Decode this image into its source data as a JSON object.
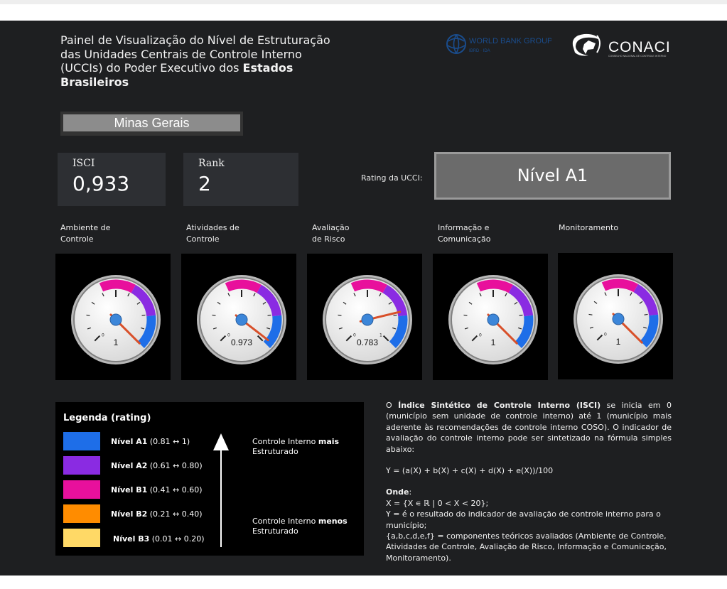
{
  "header": {
    "title_line1": "Painel de Visualização do Nível de Estruturação",
    "title_line2": "das Unidades Centrais de Controle Interno",
    "title_line3_a": "(UCCIs) do Poder Executivo dos ",
    "title_line3_b": "Estados",
    "title_line4": "Brasileiros",
    "logo1_text": "WORLD BANK GROUP",
    "logo1_sub": "IBRD · IDA",
    "logo2_text": "CONACI",
    "logo2_sub": "CONSELHO NACIONAL DE CONTROLE INTERNO"
  },
  "state_selector": {
    "value": "Minas Gerais"
  },
  "kpis": {
    "isci_label": "ISCI",
    "isci_value": "0,933",
    "rank_label": "Rank",
    "rank_value": "2"
  },
  "rating": {
    "label": "Rating da UCCI:",
    "value": "Nível A1"
  },
  "gauges": [
    {
      "label_1": "Ambiente de",
      "label_2": "Controle",
      "value": 1,
      "display": "1",
      "zero": "0"
    },
    {
      "label_1": "Atividades de",
      "label_2": "Controle",
      "value": 0.973,
      "display": "0.973",
      "zero": "0"
    },
    {
      "label_1": "Avaliação",
      "label_2": "de Risco",
      "value": 0.783,
      "display": "0.783",
      "zero": "0",
      "one": "1"
    },
    {
      "label_1": "Informação e",
      "label_2": "Comunicação",
      "value": 1,
      "display": "1",
      "zero": "0"
    },
    {
      "label_1": "Monitoramento",
      "label_2": "",
      "value": 1,
      "display": "1",
      "zero": "0"
    }
  ],
  "legend": {
    "title": "Legenda (rating)",
    "items": [
      {
        "name": "Nível A1",
        "range": "(0.81 ↔ 1)",
        "color": "#1e6ee8"
      },
      {
        "name": "Nível A2",
        "range": "(0.61 ↔ 0.80)",
        "color": "#8a2be2"
      },
      {
        "name": "Nível B1",
        "range": "(0.41 ↔ 0.60)",
        "color": "#e8109c"
      },
      {
        "name": "Nível B2",
        "range": "(0.21 ↔ 0.40)",
        "color": "#ff8c00"
      },
      {
        "name": "Nível B3",
        "range": "(0.01 ↔ 0.20)",
        "color": "#ffd966"
      }
    ],
    "more_a": "Controle Interno ",
    "more_b": "mais",
    "more_c": "Estruturado",
    "less_a": "Controle Interno ",
    "less_b": "menos",
    "less_c": "Estruturado"
  },
  "description": {
    "p1_a": "O ",
    "p1_b": "Índice Sintético de Controle Interno (ISCI)",
    "p1_c": " se inicia em 0 (município sem unidade de controle interno) até 1 (município mais aderente às recomendações de controle interno COSO). O indicador de avaliação do controle interno pode ser sintetizado na fórmula simples abaixo:",
    "formula": "Y = (a(X) + b(X) + c(X) + d(X) + e(X))/100",
    "onde": "Onde",
    "line1": "X = {X ∊ ℝ | 0 < X < 20};",
    "line2": "Y = é o resultado do indicador de avaliação de controle interno para o município;",
    "line3": "{a,b,c,d,e,f} = componentes teóricos avaliados (Ambiente de Controle, Atividades de Controle, Avaliação de Risco, Informação e Comunicação, Monitoramento)."
  }
}
